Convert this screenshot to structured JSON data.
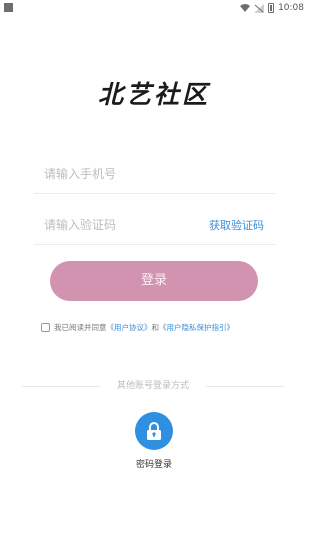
{
  "status_bar": {
    "time": "10:08"
  },
  "logo": {
    "text": "北艺社区"
  },
  "phone_field": {
    "placeholder": "请输入手机号"
  },
  "code_field": {
    "placeholder": "请输入验证码",
    "get_code_label": "获取验证码"
  },
  "login_button": {
    "label": "登录"
  },
  "agreement": {
    "prefix": "我已阅读并同意",
    "user_agreement": "《用户协议》",
    "and": "和",
    "privacy_policy": "《用户隐私保护指引》",
    "checked": false
  },
  "other_login": {
    "divider_text": "其他账号登录方式",
    "password_login_label": "密码登录"
  },
  "colors": {
    "accent_pink": "#d293b0",
    "link_blue": "#3a8ed7",
    "icon_blue": "#2f8fe0"
  }
}
